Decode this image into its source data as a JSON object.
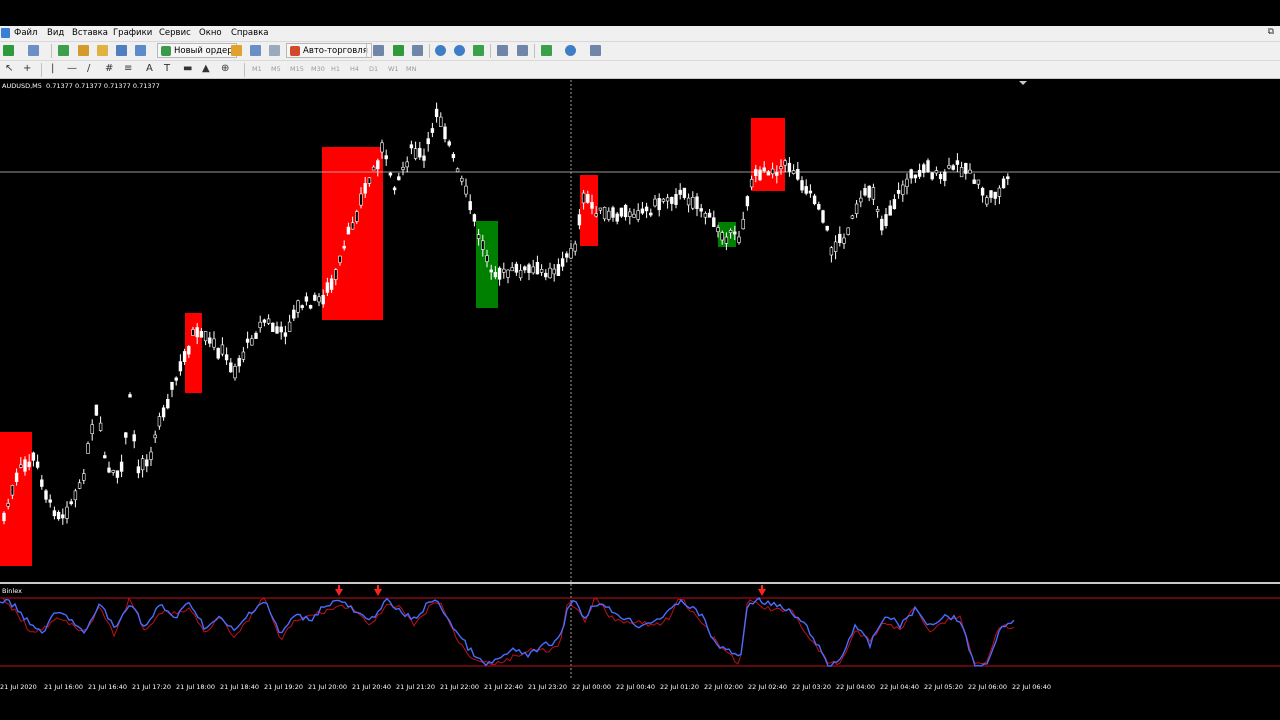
{
  "menu": [
    "Файл",
    "Вид",
    "Вставка",
    "Графики",
    "Сервис",
    "Окно",
    "Справка"
  ],
  "toolbar": {
    "new_order": "Новый ордер",
    "auto_trading": "Авто-торговля",
    "timeframes": [
      "M1",
      "M5",
      "M15",
      "M30",
      "H1",
      "H4",
      "D1",
      "W1",
      "MN"
    ]
  },
  "chart": {
    "symbol_info": "AUDUSD,M5  0.71377 0.71377 0.71377 0.71377",
    "indicator_name": "Binlex",
    "colors": {
      "bull": "#ffffff",
      "bear": "#ffffff",
      "zone_up": "#ff0000",
      "zone_down": "#008000",
      "line_blue": "#4a6cff",
      "line_red": "#c0101a",
      "grid_cross": "#c8c8c8"
    },
    "time_labels": [
      "21 Jul 2020",
      "21 Jul 16:00",
      "21 Jul 16:40",
      "21 Jul 17:20",
      "21 Jul 18:00",
      "21 Jul 18:40",
      "21 Jul 19:20",
      "21 Jul 20:00",
      "21 Jul 20:40",
      "21 Jul 21:20",
      "21 Jul 22:00",
      "21 Jul 22:40",
      "21 Jul 23:20",
      "22 Jul 00:00",
      "22 Jul 00:40",
      "22 Jul 01:20",
      "22 Jul 02:00",
      "22 Jul 02:40",
      "22 Jul 03:20",
      "22 Jul 04:00",
      "22 Jul 04:40",
      "22 Jul 05:20",
      "22 Jul 06:00",
      "22 Jul 06:40"
    ]
  }
}
